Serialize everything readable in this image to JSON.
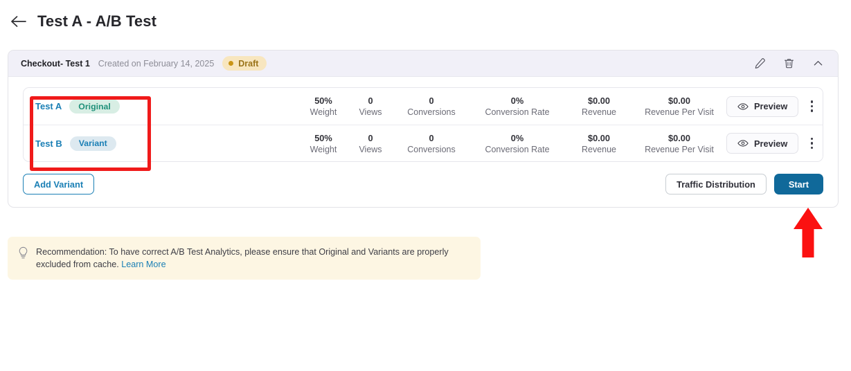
{
  "header": {
    "back_icon": "arrow-left-icon",
    "title": "Test A - A/B Test"
  },
  "test_card": {
    "name": "Checkout- Test 1",
    "created": "Created on February 14, 2025",
    "status": "Draft",
    "status_color": "#9a7318",
    "status_bg": "#f8e6bf",
    "icons": {
      "edit": "pencil-icon",
      "delete": "trash-icon",
      "collapse": "chevron-up-icon"
    },
    "columns": [
      "Weight",
      "Views",
      "Conversions",
      "Conversion Rate",
      "Revenue",
      "Revenue Per Visit"
    ],
    "variants": [
      {
        "name": "Test A",
        "type": "Original",
        "weight": "50%",
        "weight_label": "Weight",
        "views": "0",
        "views_label": "Views",
        "conversions": "0",
        "conversions_label": "Conversions",
        "conversion_rate": "0%",
        "conversion_rate_label": "Conversion Rate",
        "revenue": "$0.00",
        "revenue_label": "Revenue",
        "revenue_per_visit": "$0.00",
        "revenue_per_visit_label": "Revenue Per Visit",
        "preview_label": "Preview",
        "preview_icon": "eye-icon",
        "menu_icon": "kebab-menu-icon"
      },
      {
        "name": "Test B",
        "type": "Variant",
        "weight": "50%",
        "weight_label": "Weight",
        "views": "0",
        "views_label": "Views",
        "conversions": "0",
        "conversions_label": "Conversions",
        "conversion_rate": "0%",
        "conversion_rate_label": "Conversion Rate",
        "revenue": "$0.00",
        "revenue_label": "Revenue",
        "revenue_per_visit": "$0.00",
        "revenue_per_visit_label": "Revenue Per Visit",
        "preview_label": "Preview",
        "preview_icon": "eye-icon",
        "menu_icon": "kebab-menu-icon"
      }
    ],
    "actions": {
      "add_variant": "Add Variant",
      "traffic_distribution": "Traffic Distribution",
      "start": "Start"
    }
  },
  "banner": {
    "icon": "lightbulb-icon",
    "text": "Recommendation: To have correct A/B Test Analytics, please ensure that Original and Variants are properly excluded from cache. ",
    "link": "Learn More"
  },
  "annotations": {
    "highlight_color": "#f01a1a",
    "rect_target": "variant-name-column",
    "arrow_target": "start-button"
  },
  "theme": {
    "accent": "#1a7fb5",
    "primary_button": "#10699a",
    "header_bg": "#f1f0f8",
    "banner_bg": "#fdf6e3"
  }
}
